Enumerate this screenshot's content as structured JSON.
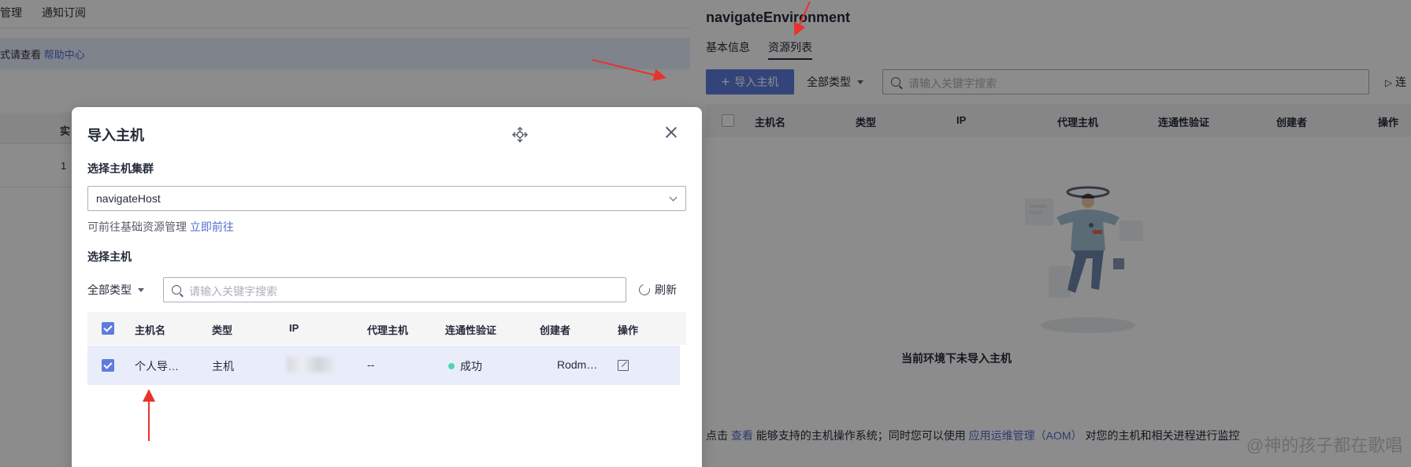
{
  "background": {
    "nav": {
      "item1": "管理",
      "item2": "通知订阅"
    },
    "notice": {
      "text": "式请查看 ",
      "link": "帮助中心"
    },
    "table": {
      "header": "实",
      "row_value": "1"
    }
  },
  "drawer": {
    "title": "navigateEnvironment",
    "tabs": [
      {
        "label": "基本信息"
      },
      {
        "label": "资源列表"
      }
    ],
    "import_button": "导入主机",
    "type_filter": "全部类型",
    "search_placeholder": "请输入关键字搜索",
    "connect_label": "连",
    "table_headers": [
      "主机名",
      "类型",
      "IP",
      "代理主机",
      "连通性验证",
      "创建者",
      "操作"
    ],
    "empty_text": "当前环境下未导入主机",
    "footer": {
      "prefix": "点击 ",
      "link1": "查看",
      "middle": " 能够支持的主机操作系统；同时您可以使用 ",
      "link2": "应用运维管理（AOM）",
      "suffix": " 对您的主机和相关进程进行监控"
    },
    "watermark": "@神的孩子都在歌唱"
  },
  "modal": {
    "title": "导入主机",
    "cluster_label": "选择主机集群",
    "cluster_value": "navigateHost",
    "hint_text": "可前往基础资源管理 ",
    "hint_link": "立即前往",
    "host_label": "选择主机",
    "type_filter": "全部类型",
    "search_placeholder": "请输入关键字搜索",
    "refresh_label": "刷新",
    "table_headers": [
      "主机名",
      "类型",
      "IP",
      "代理主机",
      "连通性验证",
      "创建者",
      "操作"
    ],
    "rows": [
      {
        "name": "个人导…",
        "type": "主机",
        "proxy": "--",
        "status": "成功",
        "creator": "Rodm…"
      }
    ]
  },
  "colors": {
    "primary": "#5e7ce0",
    "link": "#526ecc",
    "success": "#50d4ab",
    "annotation": "#e8332b"
  }
}
